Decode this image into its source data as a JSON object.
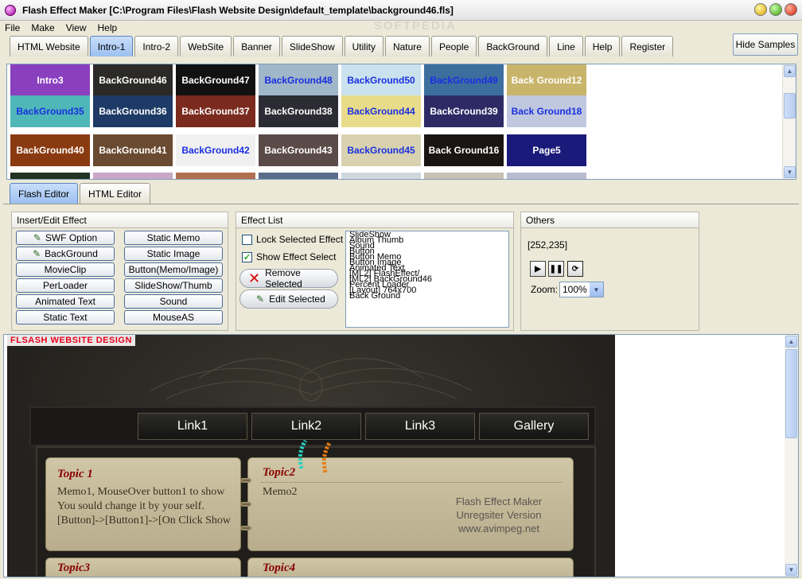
{
  "window": {
    "title": "Flash Effect Maker [C:\\Program Files\\Flash Website Design\\default_template\\background46.fls]",
    "watermark": "SOFTPEDIA"
  },
  "menu": [
    "File",
    "Make",
    "View",
    "Help"
  ],
  "top_tabs": [
    {
      "label": "HTML Website",
      "active": false
    },
    {
      "label": "Intro-1",
      "active": true
    },
    {
      "label": "Intro-2",
      "active": false
    },
    {
      "label": "WebSite",
      "active": false
    },
    {
      "label": "Banner",
      "active": false
    },
    {
      "label": "SlideShow",
      "active": false
    },
    {
      "label": "Utility",
      "active": false
    },
    {
      "label": "Nature",
      "active": false
    },
    {
      "label": "People",
      "active": false
    },
    {
      "label": "BackGround",
      "active": false
    },
    {
      "label": "Line",
      "active": false
    },
    {
      "label": "Help",
      "active": false
    },
    {
      "label": "Register",
      "active": false
    }
  ],
  "hide_samples_label": "Hide Samples",
  "gallery": {
    "rows": [
      [
        {
          "label": "Intro3",
          "bg": "#8a3fbf",
          "color": "#ffffff"
        },
        {
          "label": "BackGround46",
          "bg": "#2b2a28",
          "color": "#ffffff"
        },
        {
          "label": "BackGround47",
          "bg": "#111111",
          "color": "#ffffff"
        },
        {
          "label": "BackGround48",
          "bg": "#9fb7c8",
          "color": "#1a2ee0"
        },
        {
          "label": "BackGround50",
          "bg": "#c9e2ee",
          "color": "#1a2ee0"
        },
        {
          "label": "BackGround49",
          "bg": "#3d6f9e",
          "color": "#1a2ee0"
        },
        {
          "label": "Back Ground12",
          "bg": "#c8b46a",
          "color": "#ffffff"
        }
      ],
      [
        {
          "label": "BackGround35",
          "bg": "#4fb7b8",
          "color": "#1a2ee0"
        },
        {
          "label": "BackGround36",
          "bg": "#1d3b66",
          "color": "#ffffff"
        },
        {
          "label": "BackGround37",
          "bg": "#7b2a1e",
          "color": "#ffffff"
        },
        {
          "label": "BackGround38",
          "bg": "#2c2c34",
          "color": "#ffffff"
        },
        {
          "label": "BackGround44",
          "bg": "#e8dc8a",
          "color": "#1a2ee0"
        },
        {
          "label": "BackGround39",
          "bg": "#2e2a66",
          "color": "#ffffff"
        },
        {
          "label": "Back Ground18",
          "bg": "#c0c8e0",
          "color": "#1a2ee0"
        }
      ],
      [
        {
          "label": "BackGround40",
          "bg": "#8a3a10",
          "color": "#ffffff"
        },
        {
          "label": "BackGround41",
          "bg": "#6a4a30",
          "color": "#ffffff"
        },
        {
          "label": "BackGround42",
          "bg": "#f0f0f0",
          "color": "#1a2ee0"
        },
        {
          "label": "BackGround43",
          "bg": "#5a4a48",
          "color": "#ffffff"
        },
        {
          "label": "BackGround45",
          "bg": "#d8d2b0",
          "color": "#1a2ee0"
        },
        {
          "label": "Back Ground16",
          "bg": "#1a1412",
          "color": "#ffffff"
        },
        {
          "label": "Page5",
          "bg": "#1a1a7a",
          "color": "#ffffff"
        }
      ],
      [
        {
          "label": "",
          "bg": "#223322",
          "color": "#ffffff"
        },
        {
          "label": "",
          "bg": "#c9a8c8",
          "color": "#ffffff"
        },
        {
          "label": "",
          "bg": "#b07050",
          "color": "#ffffff"
        },
        {
          "label": "",
          "bg": "#5a6c8a",
          "color": "#ffffff"
        },
        {
          "label": "",
          "bg": "#d0d8e0",
          "color": "#ffffff"
        },
        {
          "label": "",
          "bg": "#c8c0b0",
          "color": "#ffffff"
        },
        {
          "label": "",
          "bg": "#b8bcd0",
          "color": "#ffffff"
        }
      ]
    ]
  },
  "editor_tabs": [
    {
      "label": "Flash Editor",
      "active": true
    },
    {
      "label": "HTML Editor",
      "active": false
    }
  ],
  "insert_group": {
    "title": "Insert/Edit Effect",
    "left_buttons": [
      "SWF Option",
      "BackGround",
      "MovieClip",
      "PerLoader",
      "Animated Text",
      "Static Text"
    ],
    "right_buttons": [
      "Static Memo",
      "Static Image",
      "Button(Memo/Image)",
      "SlideShow/Thumb",
      "Sound",
      "MouseAS"
    ]
  },
  "effect_group": {
    "title": "Effect List",
    "lock_label": "Lock Selected Effect",
    "lock_checked": false,
    "show_label": "Show Effect Select",
    "show_checked": true,
    "remove_label": "Remove Selected",
    "edit_label": "Edit Selected",
    "list_items": [
      "SlideShow",
      "Album Thumb",
      "Sound",
      "Button",
      "Button Memo",
      "Button Image",
      "Animated Text",
      "[ML2] FlashEffect/",
      "[ML2] BackGround46",
      "Percent Loader",
      "[Layout] 764x700",
      "Back Ground"
    ]
  },
  "others_group": {
    "title": "Others",
    "coords": "[252,235]",
    "zoom_label": "Zoom:",
    "zoom_value": "100%"
  },
  "preview": {
    "brand": "FLSASH WEBSITE DESIGN",
    "nav_links": [
      "Link1",
      "Link2",
      "Link3",
      "Gallery"
    ],
    "topic1": {
      "title": "Topic 1",
      "lines": [
        "Memo1, MouseOver button1 to show",
        "You sould change it by your self.",
        "[Button]->[Button1]->[On Click Show"
      ]
    },
    "topic2": {
      "title": "Topic2",
      "memo": "Memo2"
    },
    "topic3": {
      "title": "Topic3"
    },
    "topic4": {
      "title": "Topic4"
    },
    "unregistered": [
      "Flash Effect Maker",
      "Unregsiter Version",
      "www.avimpeg.net"
    ]
  },
  "colors": {
    "accent_tab": "#9cc0f0",
    "brand_red": "#e8001a",
    "topic_red": "#8a0000"
  }
}
